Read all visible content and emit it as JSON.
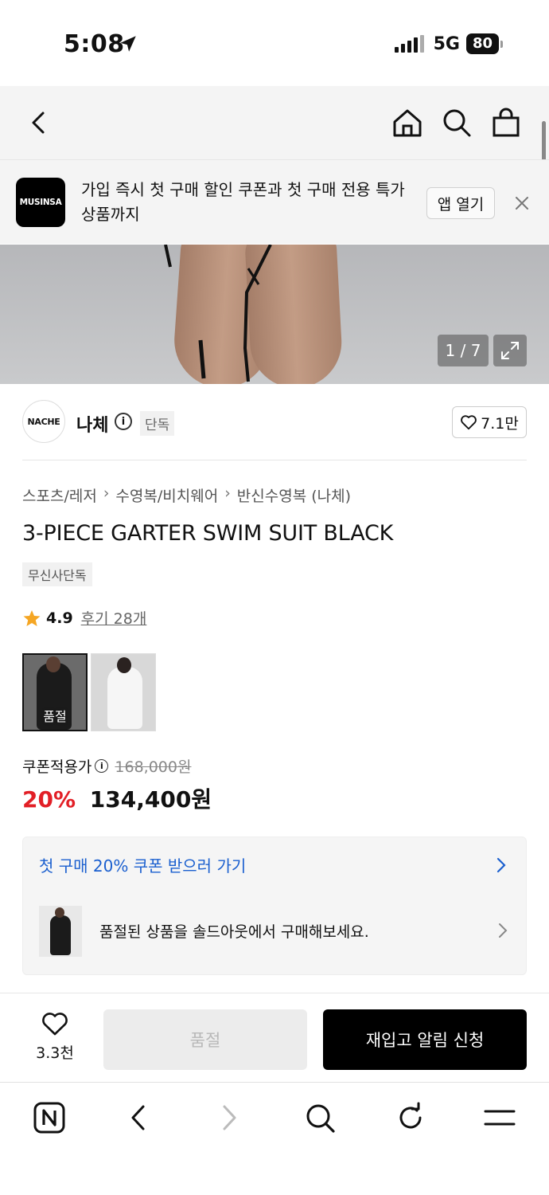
{
  "status": {
    "time": "5:08",
    "network": "5G",
    "battery": "80"
  },
  "nav": {
    "icons": [
      "back-icon",
      "home-icon",
      "search-icon",
      "shopping-bag-icon"
    ]
  },
  "banner": {
    "logo": "MUSINSA",
    "text": "가입 즉시 첫 구매 할인 쿠폰과 첫 구매 전용 특가 상품까지",
    "open_app": "앱 열기"
  },
  "gallery": {
    "counter": "1 / 7"
  },
  "brand": {
    "logo": "NACHE",
    "name": "나체",
    "tag": "단독",
    "likes": "7.1만"
  },
  "breadcrumb": [
    "스포츠/레저",
    "수영복/비치웨어",
    "반신수영복 (나체)"
  ],
  "product": {
    "title": "3-PIECE GARTER SWIM SUIT BLACK",
    "exclusive_tag": "무신사단독",
    "rating": "4.9",
    "reviews": "후기 28개",
    "sold_out_label": "품절"
  },
  "price": {
    "label": "쿠폰적용가",
    "original": "168,000원",
    "discount": "20%",
    "final": "134,400원",
    "discount_color": "#e21f26"
  },
  "promo": {
    "coupon_text": "첫 구매 20% 쿠폰 받으러 가기",
    "coupon_color": "#1a5fcf",
    "soldout_text": "품절된 상품을 솔드아웃에서 구매해보세요."
  },
  "bottom": {
    "wish_count": "3.3천",
    "soldout_button": "품절",
    "restock_button": "재입고 알림 신청"
  },
  "browser": {
    "icons": [
      "naver-icon",
      "back-icon",
      "forward-icon",
      "search-icon",
      "refresh-icon",
      "menu-icon"
    ]
  }
}
